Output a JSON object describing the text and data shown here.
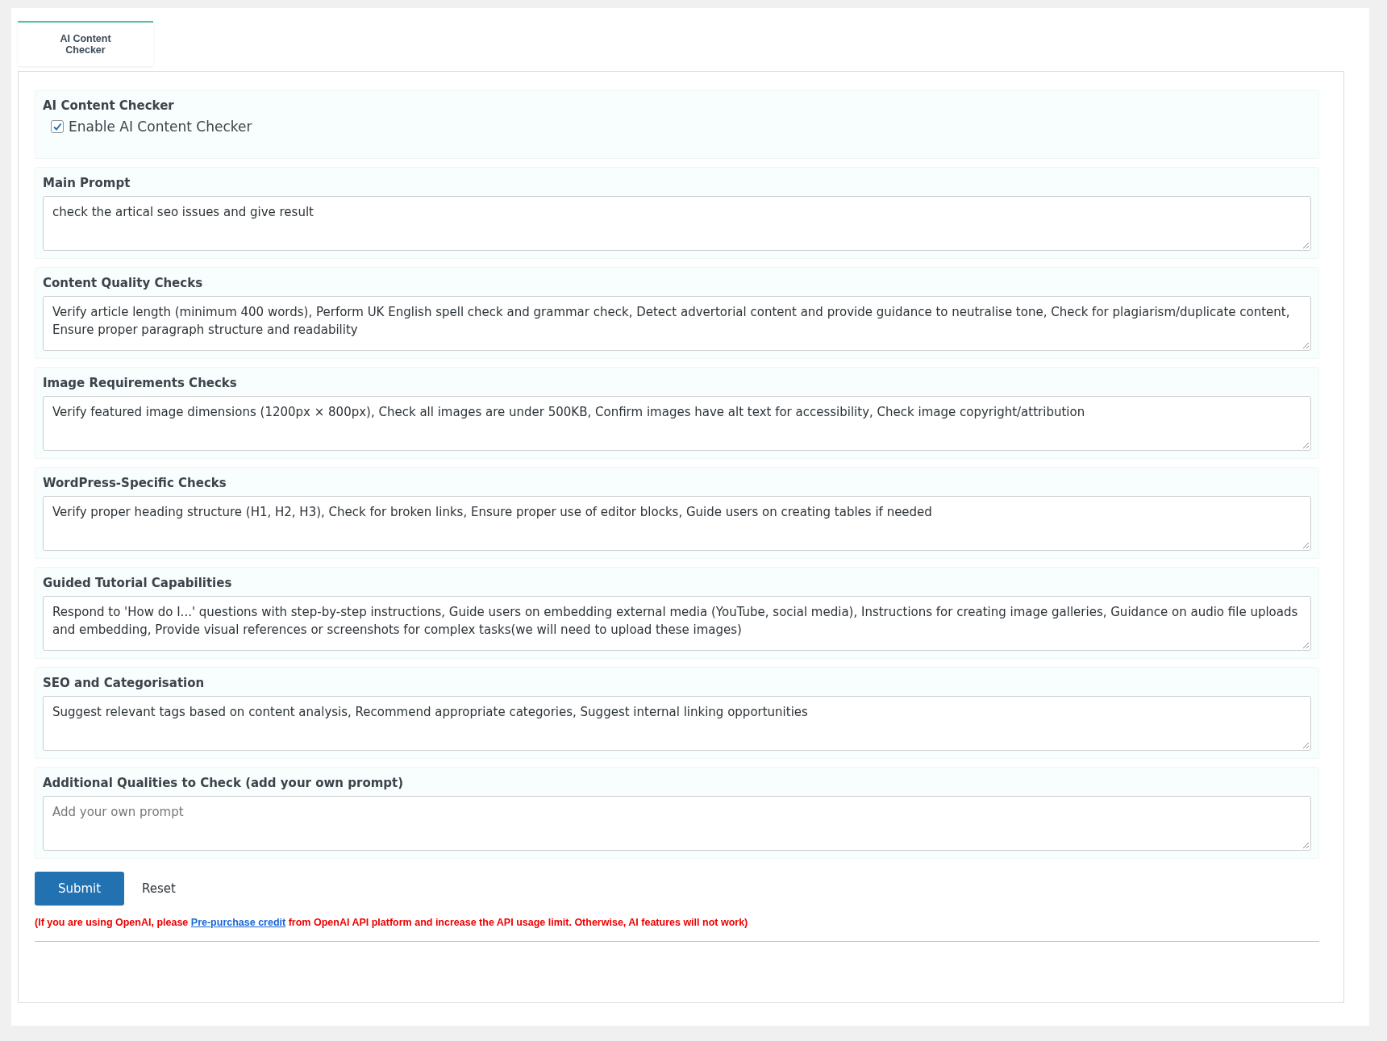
{
  "tabs": [
    {
      "label": "AI Content Checker",
      "selected": true
    }
  ],
  "sections": [
    {
      "kind": "checkbox",
      "title": "AI Content Checker",
      "label": "Enable AI Content Checker",
      "checked": true
    },
    {
      "kind": "textarea",
      "title": "Main Prompt",
      "value": "check the artical seo issues and give result"
    },
    {
      "kind": "textarea",
      "title": "Content Quality Checks",
      "value": "Verify article length (minimum 400 words), Perform UK English spell check and grammar check, Detect advertorial content and provide guidance to neutralise tone, Check for plagiarism/duplicate content, Ensure proper paragraph structure and readability"
    },
    {
      "kind": "textarea",
      "title": "Image Requirements Checks",
      "value": "Verify featured image dimensions (1200px × 800px), Check all images are under 500KB, Confirm images have alt text for accessibility, Check image copyright/attribution"
    },
    {
      "kind": "textarea",
      "title": "WordPress-Specific Checks",
      "value": "Verify proper heading structure (H1, H2, H3), Check for broken links, Ensure proper use of editor blocks, Guide users on creating tables if needed"
    },
    {
      "kind": "textarea",
      "title": "Guided Tutorial Capabilities",
      "value": "Respond to 'How do I...' questions with step-by-step instructions, Guide users on embedding external media (YouTube, social media), Instructions for creating image galleries, Guidance on audio file uploads and embedding, Provide visual references or screenshots for complex tasks(we will need to upload these images)"
    },
    {
      "kind": "textarea",
      "title": "SEO and Categorisation",
      "value": "Suggest relevant tags based on content analysis, Recommend appropriate categories, Suggest internal linking opportunities"
    },
    {
      "kind": "textarea",
      "title": "Additional Qualities to Check (add your own prompt)",
      "placeholder": "Add your own prompt"
    }
  ],
  "buttons": {
    "submit": "Submit",
    "reset": "Reset"
  },
  "notice": {
    "text_before": "(If you are using OpenAI, please ",
    "link": "Pre-purchase credit",
    "text_after": " from OpenAI API platform and increase the API usage limit. Otherwise, AI features will not work)"
  }
}
